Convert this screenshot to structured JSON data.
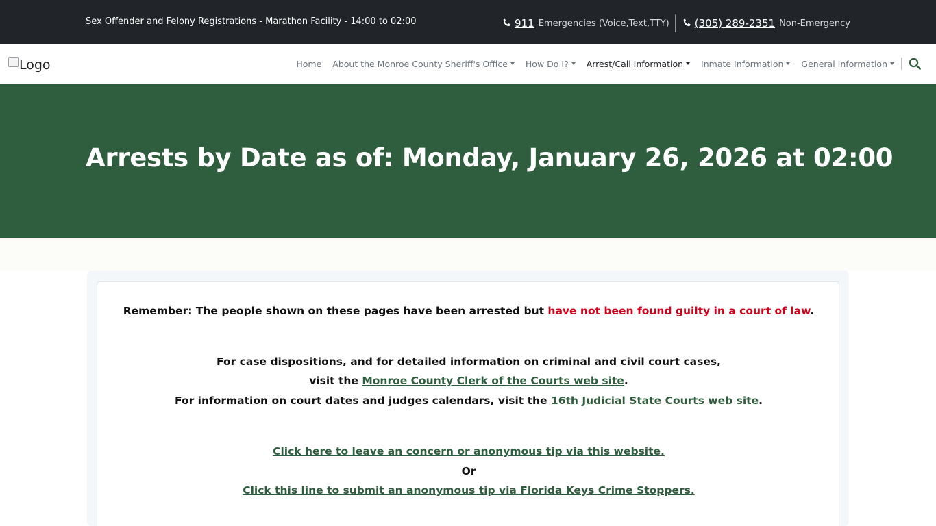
{
  "topbar": {
    "notice": "Sex Offender and Felony Registrations - Marathon Facility - 14:00 to 02:00",
    "emergency_number": "911",
    "emergency_desc": "Emergencies (Voice,Text,TTY)",
    "nonemergency_number": "(305) 289-2351",
    "nonemergency_desc": "Non-Emergency"
  },
  "navbar": {
    "logo_alt": "Logo",
    "items": [
      {
        "label": "Home"
      },
      {
        "label": "About the Monroe County Sheriff's Office"
      },
      {
        "label": "How Do I?"
      },
      {
        "label": "Arrest/Call Information"
      },
      {
        "label": "Inmate Information"
      },
      {
        "label": "General Information"
      }
    ]
  },
  "hero": {
    "title": "Arrests by Date as of: Monday, January 26, 2026 at 02:00"
  },
  "content": {
    "remember_text": "Remember: The people shown on these pages have been arrested but ",
    "remember_highlight": "have not been found guilty in a court of law",
    "remember_end": ".",
    "dispositions_line1": "For case dispositions, and for detailed information on criminal and civil court cases,",
    "dispositions_line2_prefix": "visit the ",
    "clerk_link": "Monroe County Clerk of the Courts web site",
    "period": ".",
    "court_dates_prefix": "For information on court dates and judges calendars, visit the ",
    "judicial_link": "16th Judicial State Courts web site",
    "tip_link": "Click here to leave an concern or anonymous tip via this website.",
    "or_text": "Or",
    "crimestoppers_link": "Click this line to submit an anonymous tip via Florida Keys Crime Stoppers."
  },
  "colors": {
    "topbar_bg": "#212529",
    "hero_bg": "#2e5e3d",
    "link": "#2e5e3d",
    "warning_red": "#d0021b"
  }
}
